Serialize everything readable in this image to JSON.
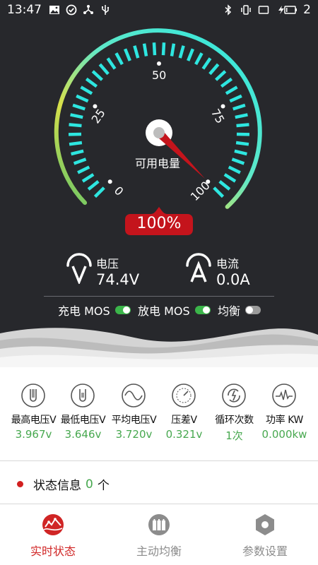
{
  "status_bar": {
    "time": "13:47",
    "left_icons": [
      "image-icon",
      "check-circle-icon",
      "share-network-icon",
      "usb-icon"
    ],
    "right_icons": [
      "bluetooth-icon",
      "vibrate-icon",
      "cast-icon",
      "battery-charging-icon"
    ],
    "battery_level": "2"
  },
  "gauge": {
    "center_label": "可用电量",
    "ticks": [
      "0",
      "25",
      "50",
      "75",
      "100"
    ],
    "value_percent": 100,
    "percent_text": "100%",
    "colors": {
      "arc_start": "#5ec26a",
      "arc_mid": "#d8e04a",
      "arc_end": "#2ee6e0",
      "tick": "#2ee6e0",
      "needle": "#c4141c",
      "badge": "#c4141c"
    }
  },
  "metrics": {
    "voltage": {
      "label": "电压",
      "value": "74.4V",
      "icon": "voltage-v-icon"
    },
    "current": {
      "label": "电流",
      "value": "0.0A",
      "icon": "current-a-icon"
    }
  },
  "mos": {
    "charge": {
      "label": "充电 MOS",
      "state": "on"
    },
    "discharge": {
      "label": "放电 MOS",
      "state": "on"
    },
    "balance": {
      "label": "均衡",
      "state": "off"
    }
  },
  "stats": [
    {
      "label": "最高电压V",
      "value": "3.967v",
      "icon": "max-voltage-icon"
    },
    {
      "label": "最低电压V",
      "value": "3.646v",
      "icon": "min-voltage-icon"
    },
    {
      "label": "平均电压V",
      "value": "3.720v",
      "icon": "avg-voltage-icon"
    },
    {
      "label": "压差V",
      "value": "0.321v",
      "icon": "voltage-diff-icon"
    },
    {
      "label": "循环次数",
      "value": "1次",
      "icon": "cycle-count-icon"
    },
    {
      "label": "功率 KW",
      "value": "0.000kw",
      "icon": "power-icon"
    }
  ],
  "status_info": {
    "label": "状态信息",
    "count": "0",
    "unit": "个"
  },
  "tabs": [
    {
      "label": "实时状态",
      "icon": "realtime-status-icon",
      "active": true
    },
    {
      "label": "主动均衡",
      "icon": "active-balance-icon",
      "active": false
    },
    {
      "label": "参数设置",
      "icon": "settings-hex-icon",
      "active": false
    }
  ]
}
